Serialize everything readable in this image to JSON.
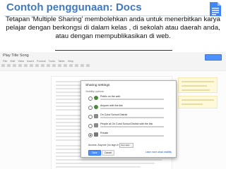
{
  "slide": {
    "title": "Contoh penggunaan: Docs",
    "caption": "Tetapan 'Multiple Sharing' membolehkan anda untuk menerbitkan karya pelajar dengan berkongsi di dalam kelas , di sekolah atau daerah anda, atau dengan mempublikasikan di web.",
    "logo_icon": "google-docs-icon"
  },
  "doc": {
    "title": "Play Title Song",
    "menu": [
      "File",
      "Edit",
      "View",
      "Insert",
      "Format",
      "Tools",
      "Table",
      "Help"
    ]
  },
  "dialog": {
    "title": "Sharing settings",
    "subtitle": "Visibility options:",
    "options": [
      {
        "title": "Public on the web",
        "icon": "globe-icon",
        "selected": false
      },
      {
        "title": "Anyone with the link",
        "icon": "link-icon",
        "selected": false
      },
      {
        "title": "On Cuhd School District",
        "icon": "building-icon",
        "selected": false
      },
      {
        "title": "People at On Cuhd School District with the link",
        "icon": "building-link-icon",
        "selected": false
      },
      {
        "title": "Private",
        "icon": "lock-icon",
        "selected": true
      }
    ],
    "access_label": "Access:  Anyone (no sign-in required)",
    "access_value": "Can view",
    "save": "Save",
    "cancel": "Cancel",
    "learn_more": "Learn more about visibility"
  }
}
